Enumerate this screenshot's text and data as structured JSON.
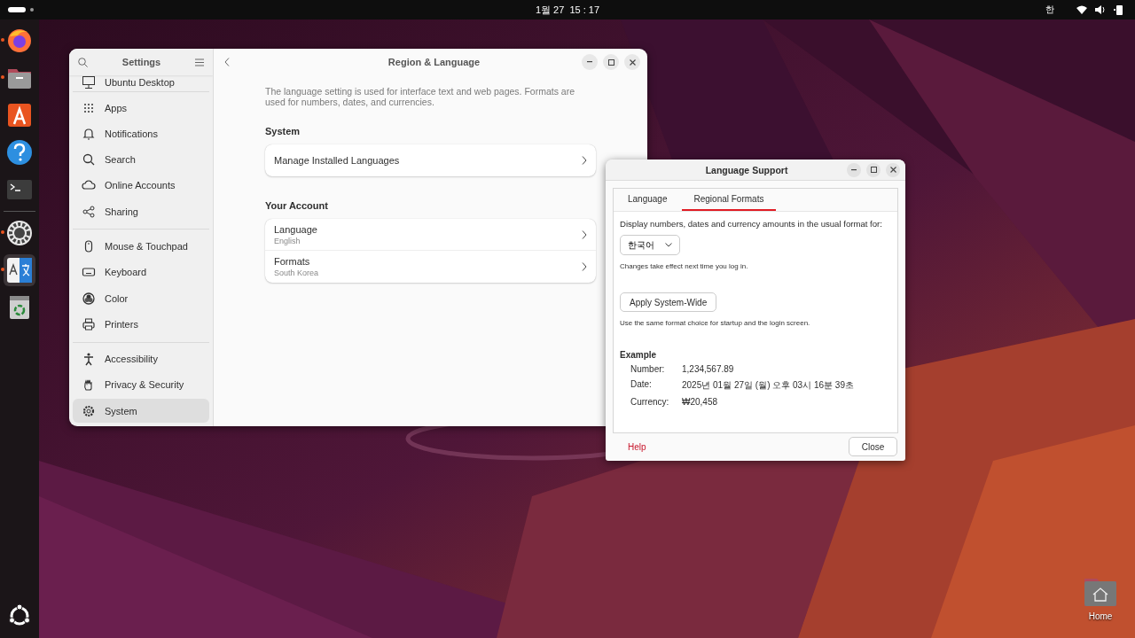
{
  "top_bar": {
    "clock": "1월 27  15 : 17",
    "input_method": "한"
  },
  "dock": {
    "apps": [
      {
        "kind": "firefox",
        "running": true,
        "focused": false
      },
      {
        "kind": "files",
        "running": true,
        "focused": false
      },
      {
        "kind": "appcenter",
        "running": false,
        "focused": false
      },
      {
        "kind": "help",
        "running": false,
        "focused": false
      },
      {
        "kind": "terminal",
        "running": false,
        "focused": false
      },
      {
        "kind": "separator"
      },
      {
        "kind": "settings",
        "running": true,
        "focused": false
      },
      {
        "kind": "language",
        "running": true,
        "focused": true
      },
      {
        "kind": "trash",
        "running": false,
        "focused": false
      }
    ]
  },
  "settings": {
    "title": "Settings",
    "page_title": "Region & Language",
    "sidebar": {
      "groups": [
        {
          "items": [
            {
              "label": "Ubuntu Desktop",
              "selected": false
            }
          ]
        },
        {
          "items": [
            {
              "label": "Apps",
              "selected": false
            },
            {
              "label": "Notifications",
              "selected": false
            },
            {
              "label": "Search",
              "selected": false
            },
            {
              "label": "Online Accounts",
              "selected": false
            },
            {
              "label": "Sharing",
              "selected": false
            }
          ]
        },
        {
          "items": [
            {
              "label": "Mouse & Touchpad",
              "selected": false
            },
            {
              "label": "Keyboard",
              "selected": false
            },
            {
              "label": "Color",
              "selected": false
            },
            {
              "label": "Printers",
              "selected": false
            }
          ]
        },
        {
          "items": [
            {
              "label": "Accessibility",
              "selected": false
            },
            {
              "label": "Privacy & Security",
              "selected": false
            },
            {
              "label": "System",
              "selected": true
            }
          ]
        }
      ]
    },
    "description": "The language setting is used for interface text and web pages. Formats are used for numbers, dates, and currencies.",
    "sections": [
      {
        "heading": "System",
        "rows": [
          {
            "title": "Manage Installed Languages"
          }
        ]
      },
      {
        "heading": "Your Account",
        "rows": [
          {
            "title": "Language",
            "subtitle": "English"
          },
          {
            "title": "Formats",
            "subtitle": "South Korea"
          }
        ]
      }
    ]
  },
  "language_support": {
    "title": "Language Support",
    "tabs": [
      {
        "label": "Language",
        "selected": false
      },
      {
        "label": "Regional Formats",
        "selected": true
      }
    ],
    "prompt": "Display numbers, dates and currency amounts in the usual format for:",
    "format_choice": "한국어",
    "login_note": "Changes take effect next time you log in.",
    "apply_button": "Apply System-Wide",
    "apply_note": "Use the same format choice for startup and the login screen.",
    "example_heading": "Example",
    "examples": [
      {
        "label": "Number:",
        "value": "1,234,567.89"
      },
      {
        "label": "Date:",
        "value": "2025년 01월 27일 (월) 오후 03시 16분 39초"
      },
      {
        "label": "Currency:",
        "value": "₩20,458"
      }
    ],
    "help": "Help",
    "close": "Close"
  },
  "desktop_icons": [
    {
      "label": "Home"
    }
  ]
}
